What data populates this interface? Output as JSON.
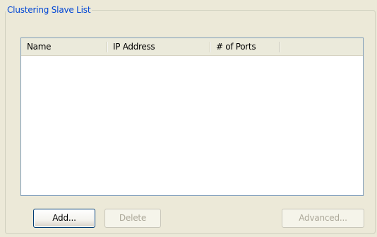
{
  "groupbox": {
    "title": "Clustering Slave List"
  },
  "listview": {
    "columns": [
      {
        "label": "Name"
      },
      {
        "label": "IP Address"
      },
      {
        "label": "# of Ports"
      }
    ],
    "rows": []
  },
  "buttons": {
    "add": {
      "label": "Add...",
      "enabled": true
    },
    "delete": {
      "label": "Delete",
      "enabled": false
    },
    "advanced": {
      "label": "Advanced...",
      "enabled": false
    }
  },
  "colors": {
    "title": "#0046d5",
    "background": "#ece9d8",
    "list_border": "#7f9db9",
    "disabled_text": "#aca899"
  }
}
